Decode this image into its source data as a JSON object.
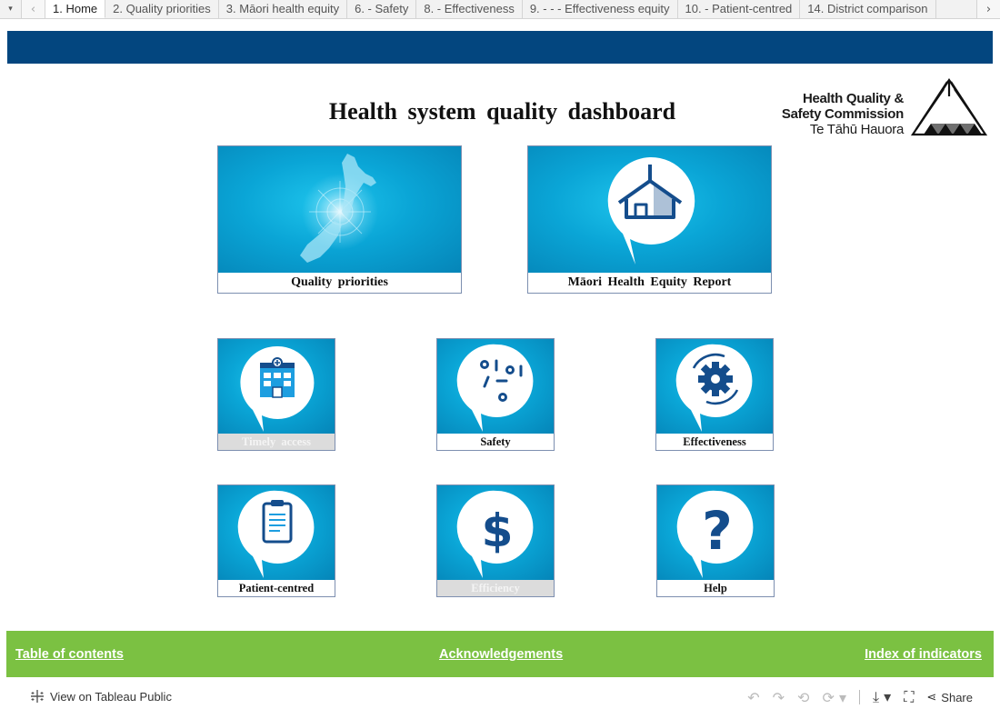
{
  "tabs": {
    "items": [
      {
        "label": "1. Home",
        "active": true
      },
      {
        "label": "2. Quality priorities"
      },
      {
        "label": "3. Māori health equity"
      },
      {
        "label": "6. - Safety"
      },
      {
        "label": "8. - Effectiveness"
      },
      {
        "label": "9. - - - Effectiveness equity"
      },
      {
        "label": "10. - Patient-centred"
      },
      {
        "label": "14. District comparison"
      }
    ],
    "menu_icon": "▾",
    "prev_icon": "‹",
    "next_icon": "›"
  },
  "header": {
    "title": "Health system quality dashboard",
    "banner_color": "#03467f"
  },
  "logo": {
    "line1": "Health Quality &",
    "line2": "Safety Commission",
    "line3": "Te Tāhū Hauora"
  },
  "tiles": {
    "quality_priorities": {
      "label": "Quality priorities",
      "icon": "nz-map-icon"
    },
    "maori_equity": {
      "label": "Māori Health Equity Report",
      "icon": "wharenui-icon"
    },
    "timely_access": {
      "label": "Timely access",
      "icon": "hospital-icon",
      "faded": true
    },
    "safety": {
      "label": "Safety",
      "icon": "scatter-icon"
    },
    "effectiveness": {
      "label": "Effectiveness",
      "icon": "gear-cycle-icon"
    },
    "patient_centred": {
      "label": "Patient-centred",
      "icon": "clipboard-icon"
    },
    "efficiency": {
      "label": "Efficiency",
      "icon": "dollar-icon",
      "faded": true
    },
    "help": {
      "label": "Help",
      "icon": "question-icon"
    }
  },
  "footer": {
    "toc": "Table of contents",
    "acknowledgements": "Acknowledgements",
    "index": "Index of indicators",
    "color": "#7bc142"
  },
  "toolbar": {
    "view_on": "View on Tableau Public",
    "share": "Share"
  }
}
